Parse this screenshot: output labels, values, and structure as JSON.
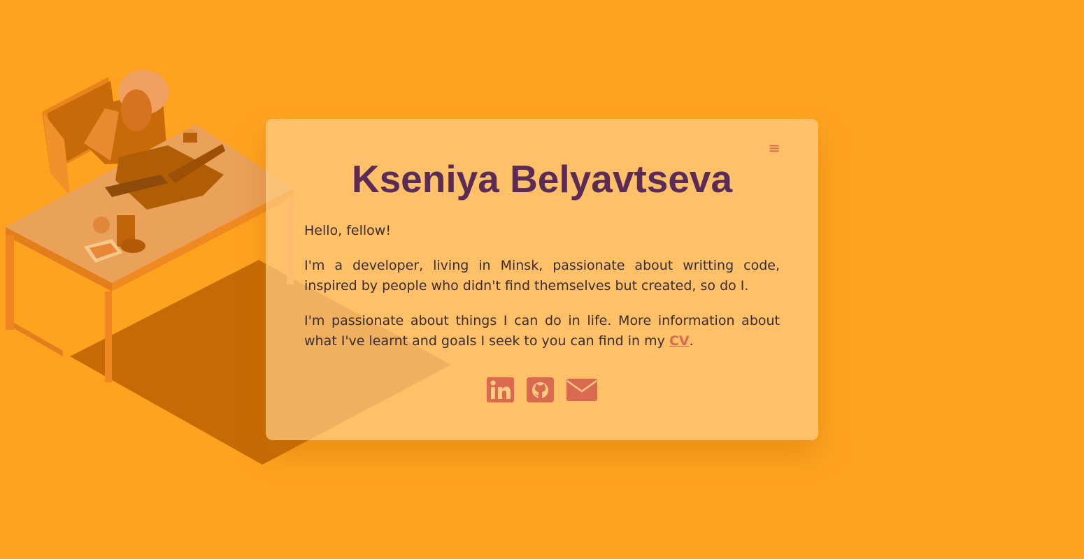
{
  "profile": {
    "name": "Kseniya Belyavtseva",
    "greeting": "Hello, fellow!",
    "bio": "I'm a developer, living in Minsk, passionate about writting code, inspired by people who didn't find themselves but created, so do I.",
    "more_before": "I'm passionate about things I can do in life. More information about what I've learnt and goals I seek to you can find in my ",
    "cv_label": "CV",
    "more_after": "."
  },
  "menu": {
    "icon": "hamburger-menu-icon"
  },
  "socials": [
    {
      "name": "linkedin",
      "icon": "linkedin-icon"
    },
    {
      "name": "github",
      "icon": "github-icon"
    },
    {
      "name": "email",
      "icon": "envelope-icon"
    }
  ],
  "colors": {
    "background": "#ffa220",
    "card": "#ffcc82",
    "title": "#5a2b55",
    "text": "#3a2c33",
    "accent": "#d9694f"
  }
}
